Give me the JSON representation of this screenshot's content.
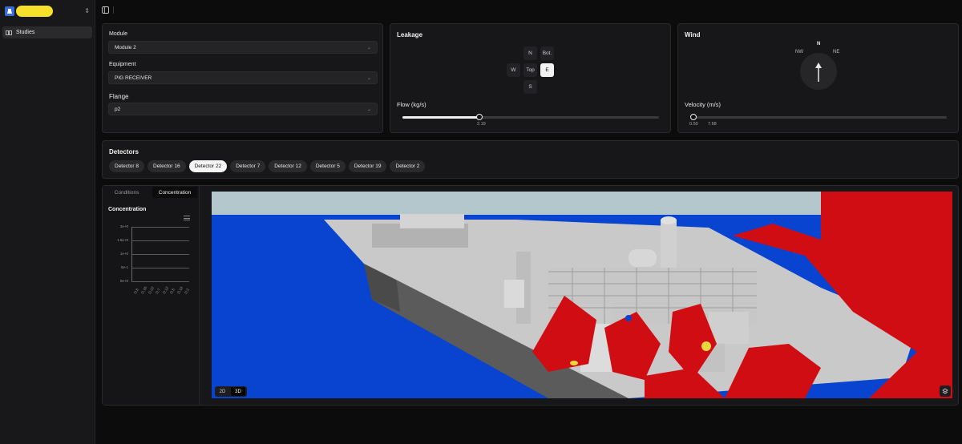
{
  "sidebar": {
    "items": [
      {
        "label": "Studies"
      }
    ]
  },
  "module": {
    "label": "Module",
    "value": "Module 2"
  },
  "equipment": {
    "label": "Equipment",
    "value": "PIG RECEIVER"
  },
  "flange": {
    "label": "Flange",
    "value": "p2"
  },
  "leakage": {
    "title": "Leakage",
    "directions": {
      "north": "N",
      "bottom": "Bot.",
      "west": "W",
      "top": "Top",
      "east": "E",
      "south": "S"
    },
    "selected": "E",
    "flow_label": "Flow (kg/s)",
    "flow_value": "2.19",
    "flow_fraction": 0.3
  },
  "wind": {
    "title": "Wind",
    "compass": {
      "n": "N",
      "nw": "NW",
      "ne": "NE"
    },
    "direction": "N",
    "velocity_label": "Velocity (m/s)",
    "velocity_ticks": [
      "0.50",
      "7.68"
    ],
    "velocity_fraction": 0.0
  },
  "detectors": {
    "title": "Detectors",
    "items": [
      "Detector 8",
      "Detector 16",
      "Detector 22",
      "Detector 7",
      "Detector 12",
      "Detector 5",
      "Detector 19",
      "Detector 2"
    ],
    "selected": "Detector 22"
  },
  "tabs": {
    "conditions": "Conditions",
    "concentration": "Concentration",
    "active": "Concentration"
  },
  "concentration_chart": {
    "title": "Concentration",
    "chart_data": {
      "type": "bar",
      "title": "Concentration",
      "y_ticks": [
        "2e+0",
        "1.5e+0",
        "1e+0",
        "5e-1",
        "0e+0"
      ],
      "categories": [
        "D.8",
        "D.16",
        "D.22",
        "D.7",
        "D.12",
        "D.5",
        "D.19",
        "D.2"
      ],
      "values": [
        0,
        0,
        0,
        0,
        0,
        0,
        0,
        0
      ],
      "ylim": [
        0,
        2
      ]
    }
  },
  "view": {
    "mode_2d": "2D",
    "mode_3d": "3D",
    "active": "3D"
  },
  "colors": {
    "sea": "#0844cf",
    "sky": "#b3c7cc",
    "plume": "#d10d14",
    "ship": "#c7c7c7",
    "accent": "#3b6bd8"
  }
}
